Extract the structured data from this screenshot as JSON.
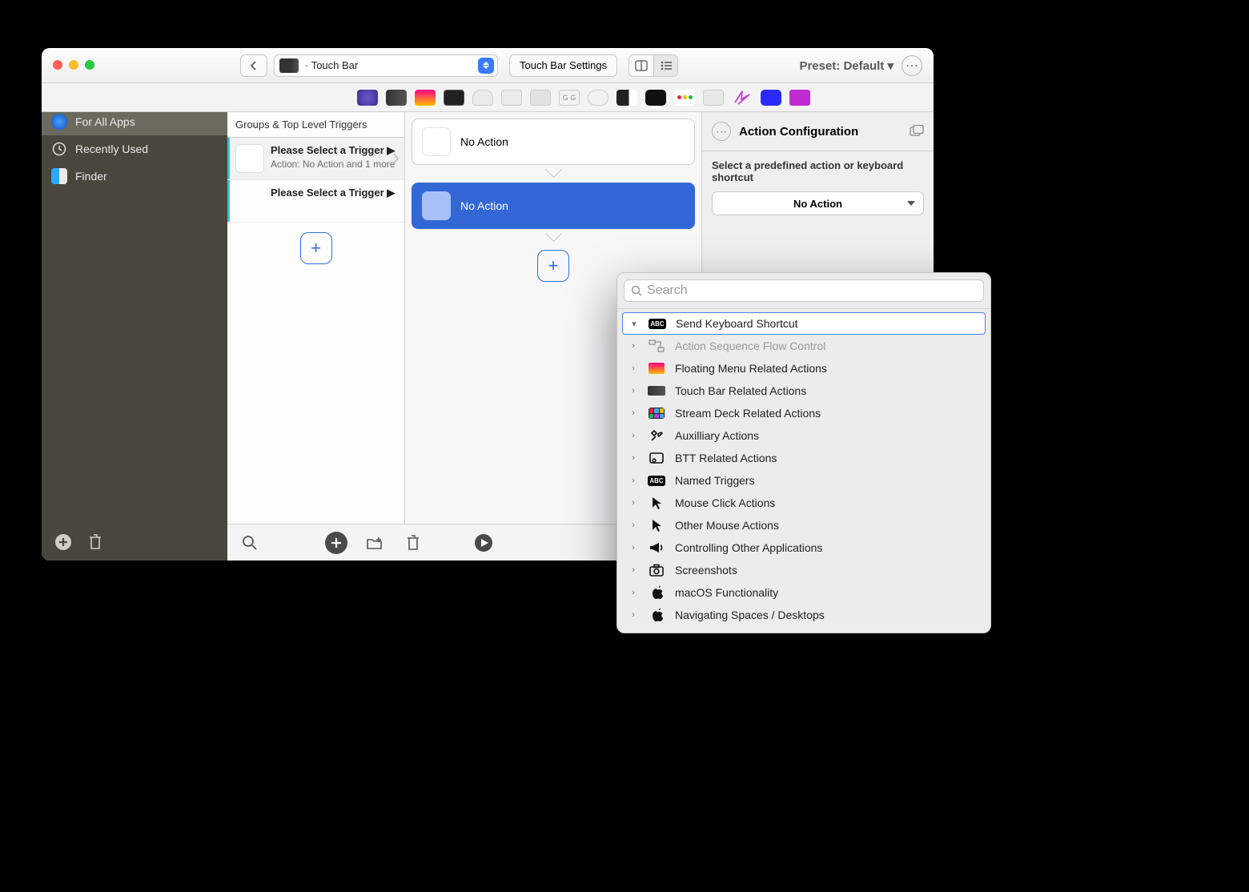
{
  "toolbar": {
    "collapse_label": "<<<",
    "dropdown_text": "· Touch Bar",
    "settings_label": "Touch Bar Settings",
    "preset_label": "Preset: Default ▾"
  },
  "sidebar": {
    "items": [
      {
        "label": "For All Apps",
        "icon": "globe"
      },
      {
        "label": "Recently Used",
        "icon": "clock"
      },
      {
        "label": "Finder",
        "icon": "finder"
      }
    ]
  },
  "triggers": {
    "header": "Groups & Top Level Triggers",
    "items": [
      {
        "title": "Please Select a Trigger ▶",
        "sub": "Action: No Action and 1 more"
      },
      {
        "title": "Please Select a Trigger ▶",
        "sub": ""
      }
    ]
  },
  "actions": {
    "items": [
      {
        "label": "No Action",
        "selected": false
      },
      {
        "label": "No Action",
        "selected": true
      }
    ]
  },
  "config": {
    "title": "Action Configuration",
    "label": "Select a predefined action or keyboard shortcut",
    "select_value": "No Action"
  },
  "popover": {
    "search_placeholder": "Search",
    "rows": [
      {
        "label": "Send Keyboard Shortcut",
        "icon": "abc",
        "selected": true,
        "chev": "down"
      },
      {
        "label": "Action Sequence Flow Control",
        "icon": "flow",
        "dim": true,
        "chev": "right"
      },
      {
        "label": "Floating Menu Related Actions",
        "icon": "menu",
        "chev": "right"
      },
      {
        "label": "Touch Bar Related Actions",
        "icon": "touchbar",
        "chev": "right"
      },
      {
        "label": "Stream Deck Related Actions",
        "icon": "streamdeck",
        "chev": "right"
      },
      {
        "label": "Auxilliary Actions",
        "icon": "tools",
        "chev": "right"
      },
      {
        "label": "BTT Related Actions",
        "icon": "btt",
        "chev": "right"
      },
      {
        "label": "Named Triggers",
        "icon": "abc",
        "chev": "right"
      },
      {
        "label": "Mouse Click Actions",
        "icon": "cursor",
        "chev": "right"
      },
      {
        "label": "Other Mouse Actions",
        "icon": "cursor",
        "chev": "right"
      },
      {
        "label": "Controlling Other Applications",
        "icon": "megaphone",
        "chev": "right"
      },
      {
        "label": "Screenshots",
        "icon": "camera",
        "chev": "right"
      },
      {
        "label": "macOS Functionality",
        "icon": "apple",
        "chev": "right"
      },
      {
        "label": "Navigating Spaces / Desktops",
        "icon": "apple",
        "chev": "right"
      }
    ]
  }
}
